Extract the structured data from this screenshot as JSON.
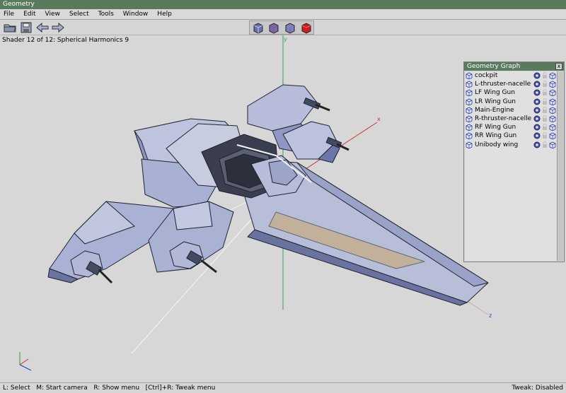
{
  "window": {
    "title": "Geometry"
  },
  "menu": [
    "File",
    "Edit",
    "View",
    "Select",
    "Tools",
    "Window",
    "Help"
  ],
  "toolbar": {
    "icons": [
      "open-folder-icon",
      "save-disk-icon",
      "back-arrow-icon",
      "forward-arrow-icon"
    ],
    "shader_buttons": [
      "wireframe-cube-icon",
      "flat-cube-icon",
      "smooth-cube-icon",
      "red-cube-icon"
    ]
  },
  "viewport": {
    "shader_label": "Shader 12 of 12: Spherical Harmonics 9",
    "axes": {
      "x": "x",
      "y": "y",
      "z": "z"
    }
  },
  "geometry_graph": {
    "title": "Geometry Graph",
    "close_label": "x",
    "objects": [
      "cockpit",
      "L-thruster-nacelle",
      "LF Wing Gun",
      "LR Wing Gun",
      "Main-Engine",
      "R-thruster-nacelle",
      "RF Wing Gun",
      "RR Wing Gun",
      "Unibody wing"
    ]
  },
  "status": {
    "hints": "L: Select   M: Start camera   R: Show menu   [Ctrl]+R: Tweak menu",
    "tweak": "Tweak: Disabled"
  },
  "colors": {
    "titlebar": "#5a7a5e",
    "ship_light": "#c6cbe0",
    "ship_mid": "#9aa2c8",
    "ship_dark": "#2f3240",
    "axis_x": "#d03030",
    "axis_y": "#20a040",
    "axis_z": "#2040c0"
  }
}
